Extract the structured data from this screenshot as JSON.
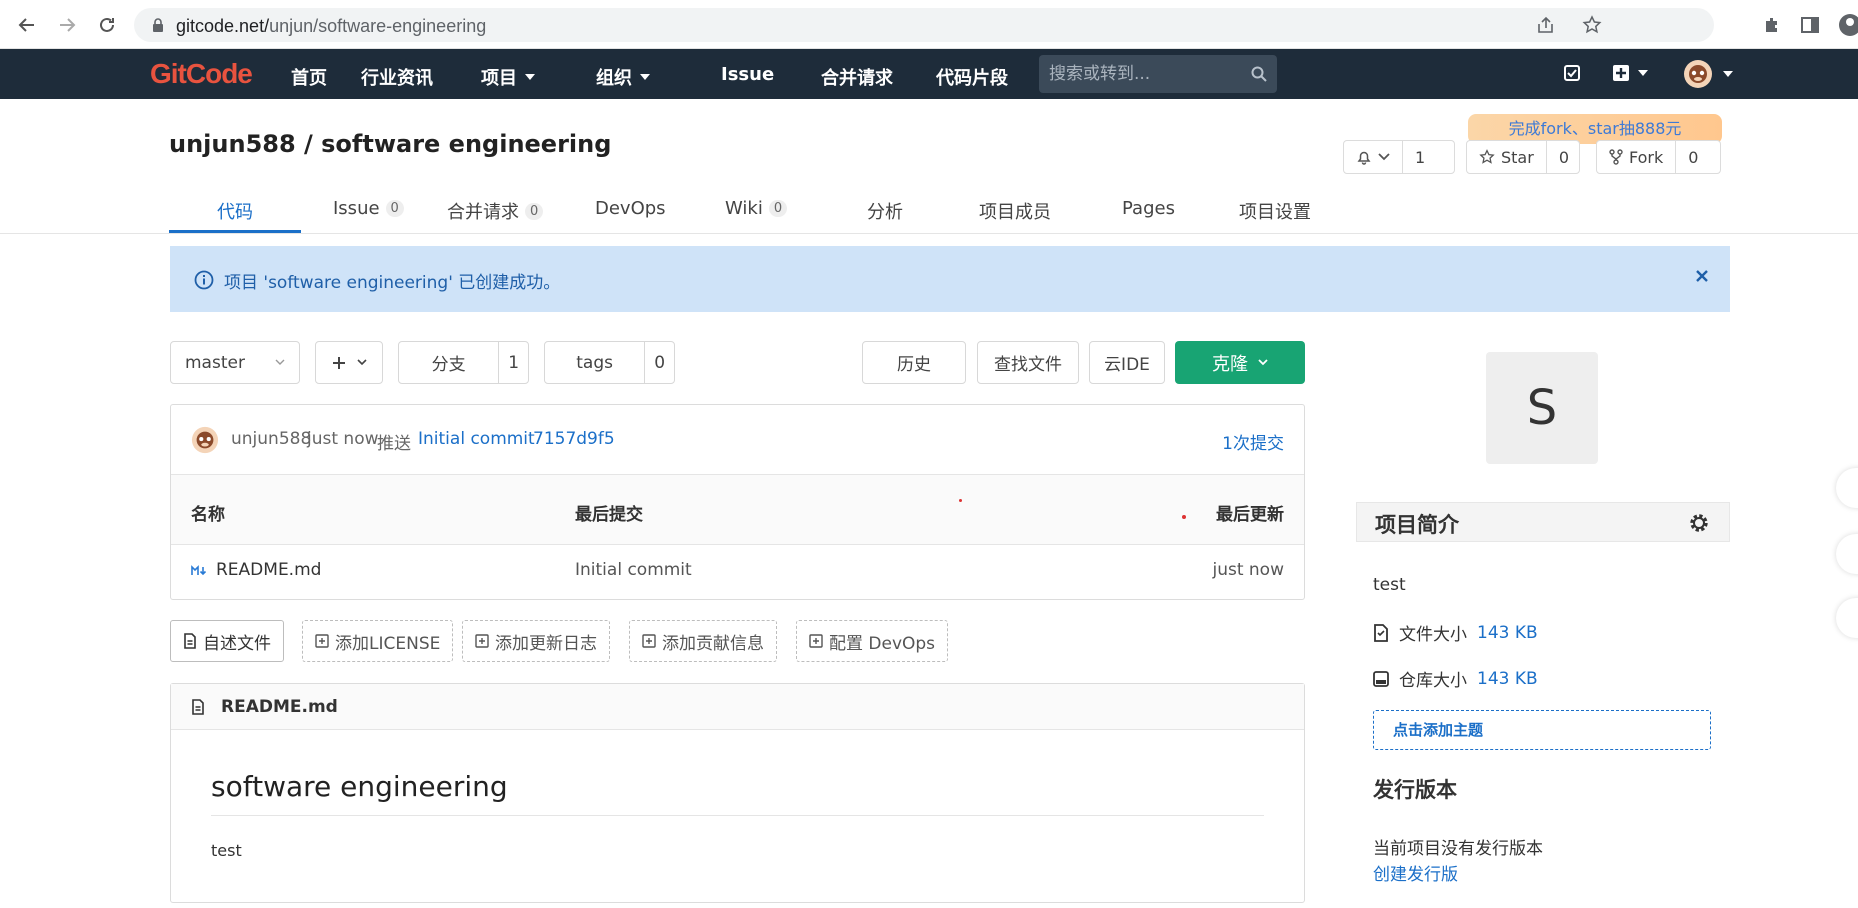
{
  "browser": {
    "url_host": "gitcode.net/",
    "url_path": "unjun/software-engineering"
  },
  "topnav": {
    "logo": "GitCode",
    "items": [
      "首页",
      "行业资讯",
      "项目",
      "组织",
      "Issue",
      "合并请求",
      "代码片段"
    ],
    "search_placeholder": "搜索或转到..."
  },
  "project": {
    "title": "unjun588 / software engineering",
    "promo": "完成fork、star抽888元",
    "notify_count": "1",
    "star_label": "Star",
    "star_count": "0",
    "fork_label": "Fork",
    "fork_count": "0"
  },
  "tabs": [
    {
      "label": "代码",
      "badge": null
    },
    {
      "label": "Issue",
      "badge": "0"
    },
    {
      "label": "合并请求",
      "badge": "0"
    },
    {
      "label": "DevOps",
      "badge": null
    },
    {
      "label": "Wiki",
      "badge": "0"
    },
    {
      "label": "分析",
      "badge": null
    },
    {
      "label": "项目成员",
      "badge": null
    },
    {
      "label": "Pages",
      "badge": null
    },
    {
      "label": "项目设置",
      "badge": null
    }
  ],
  "alert": {
    "text": "项目 'software engineering' 已创建成功。"
  },
  "toolbar": {
    "branch": "master",
    "branches_label": "分支",
    "branches_count": "1",
    "tags_label": "tags",
    "tags_count": "0",
    "history": "历史",
    "find_file": "查找文件",
    "cloud_ide": "云IDE",
    "clone": "克隆"
  },
  "commit": {
    "author": "unjun588",
    "time": "just now",
    "action": "推送",
    "message": "Initial commit",
    "sha": "7157d9f5",
    "count": "1次提交"
  },
  "table": {
    "headers": [
      "名称",
      "最后提交",
      "最后更新"
    ],
    "rows": [
      {
        "name": "README.md",
        "commit": "Initial commit",
        "updated": "just now"
      }
    ]
  },
  "readme_buttons": [
    "自述文件",
    "添加LICENSE",
    "添加更新日志",
    "添加贡献信息",
    "配置 DevOps"
  ],
  "readme": {
    "file": "README.md",
    "heading": "software engineering",
    "body": "test"
  },
  "sidebar": {
    "avatar_letter": "S",
    "intro_title": "项目简介",
    "description": "test",
    "file_size_label": "文件大小",
    "file_size": "143 KB",
    "repo_size_label": "仓库大小",
    "repo_size": "143 KB",
    "add_topic": "点击添加主题",
    "releases_title": "发行版本",
    "no_releases": "当前项目没有发行版本",
    "create_release": "创建发行版"
  },
  "colors": {
    "nav_bg": "#1e2c3a",
    "accent": "#1b6fc8",
    "clone_green": "#18a473",
    "logo_red": "#e8533f"
  }
}
